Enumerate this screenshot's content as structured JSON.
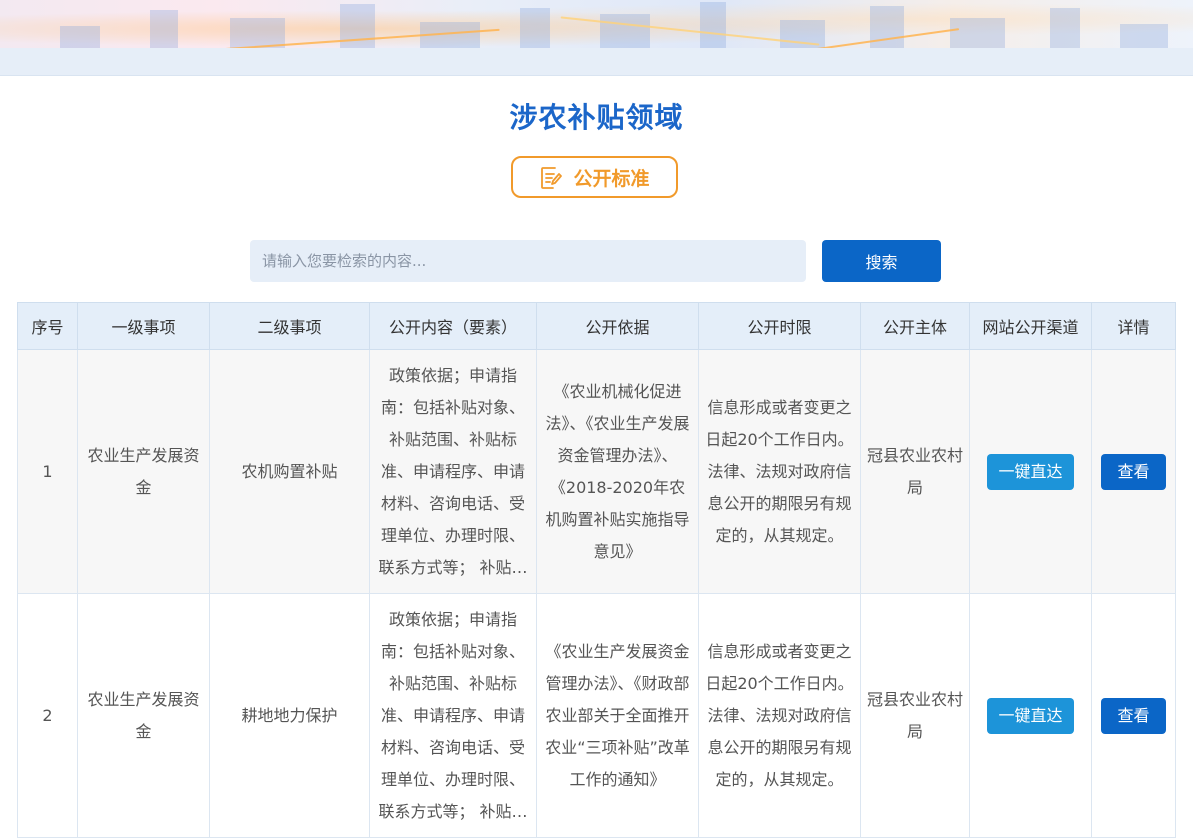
{
  "page": {
    "title": "涉农补贴领域",
    "standard_button": "公开标准",
    "search": {
      "placeholder": "请输入您要检索的内容...",
      "button": "搜索"
    }
  },
  "table": {
    "headers": [
      "序号",
      "一级事项",
      "二级事项",
      "公开内容（要素）",
      "公开依据",
      "公开时限",
      "公开主体",
      "网站公开渠道",
      "详情"
    ],
    "rows": [
      {
        "index": "1",
        "level1": "农业生产发展资金",
        "level2": "农机购置补贴",
        "content": "政策依据；申请指南：包括补贴对象、补贴范围、补贴标准、申请程序、申请材料、咨询电话、受理单位、办理时限、联系方式等； 补贴对象",
        "basis": "《农业机械化促进法》、《农业生产发展资金管理办法》、《2018-2020年农机购置补贴实施指导意见》",
        "time_limit": "信息形成或者变更之日起20个工作日内。法律、法规对政府信息公开的期限另有规定的，从其规定。",
        "subject": "冠县农业农村局",
        "channel_button": "一键直达",
        "detail_button": "查看"
      },
      {
        "index": "2",
        "level1": "农业生产发展资金",
        "level2": "耕地地力保护",
        "content": "政策依据；申请指南：包括补贴对象、补贴范围、补贴标准、申请程序、申请材料、咨询电话、受理单位、办理时限、联系方式等； 补贴对象",
        "basis": "《农业生产发展资金管理办法》、《财政部 农业部关于全面推开农业“三项补贴”改革工作的通知》",
        "time_limit": "信息形成或者变更之日起20个工作日内。法律、法规对政府信息公开的期限另有规定的，从其规定。",
        "subject": "冠县农业农村局",
        "channel_button": "一键直达",
        "detail_button": "查看"
      }
    ]
  },
  "colors": {
    "primary": "#0b66c7",
    "title": "#1b66c9",
    "accent": "#f19a2b",
    "direct": "#1d94d9",
    "header_bg": "#e4eef9"
  },
  "icons": {
    "standard": "document-edit-icon"
  }
}
